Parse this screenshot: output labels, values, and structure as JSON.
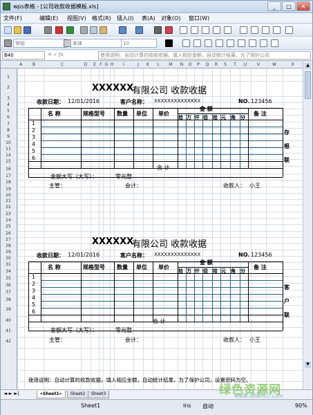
{
  "window": {
    "title": "wps表格 - [公司收款收据模板.xls]",
    "min": "_",
    "max": "□",
    "close": "✕"
  },
  "menu": [
    "文件(F)",
    "编辑(E)",
    "视图(V)",
    "格式(R)",
    "插入(I)",
    "表(A)",
    "对象(O)",
    "窗口(W)"
  ],
  "format_bar": {
    "style": "常规",
    "font": "宋体",
    "size": "10"
  },
  "formula_bar": {
    "name_box": "B40",
    "value": "使用说明：自动计算的收款收据，填入相应金额，自动统计结果，为了保护公司"
  },
  "columns": [
    "A",
    "B",
    "C",
    "D",
    "E",
    "F",
    "G",
    "H",
    "I",
    "J",
    "K",
    "L",
    "M",
    "N",
    "O",
    "P",
    "Q",
    "R",
    "S",
    "T",
    "U",
    "V",
    "W",
    "X"
  ],
  "rows": [
    "1",
    "2",
    "3",
    "4",
    "5",
    "6",
    "7",
    "8",
    "9",
    "10",
    "11",
    "14",
    "15",
    "16",
    "17",
    "18",
    "19",
    "20",
    "21",
    "22",
    "23",
    "24",
    "25",
    "26",
    "27",
    "28",
    "29",
    "30",
    "31",
    "34",
    "35",
    "36",
    "37",
    "38",
    "39",
    "40",
    "41",
    "42"
  ],
  "receipt": {
    "title_x": "XXXXXX",
    "title_rest": "有限公司  收款收据",
    "date_label": "收款日期：",
    "date_value": "12/01/2016",
    "client_label": "客户名称：",
    "client_value": "XXXXXXXXXXXXXX",
    "no_label": "NO.",
    "no_value": "123456",
    "h_name": "名  称",
    "h_spec": "规格型号",
    "h_qty": "数量",
    "h_unit": "单位",
    "h_price": "单价",
    "h_amount": "金      额",
    "h_remark": "备    注",
    "digits": [
      "拾",
      "万",
      "仟",
      "佰",
      "拾",
      "元",
      "角",
      "分"
    ],
    "items": [
      "1",
      "2",
      "3",
      "4",
      "5",
      "6"
    ],
    "total_label": "合  计",
    "amt_words_label": "金额大写（大写）：",
    "amt_words_value": "零元整",
    "manager": "主管：",
    "accountant": "会计：",
    "payee_label": "收款人：",
    "payee_value": "小王"
  },
  "copy1": [
    "存",
    "根",
    "联"
  ],
  "copy2": [
    "客",
    "户",
    "联"
  ],
  "note": "使用说明：自动计算的收款收据，填入相应金额，自动统计结果，为了保护公司，设置密码为空。",
  "sheets": [
    "«Sheet1»",
    "Sheet2",
    "Sheet3"
  ],
  "status": {
    "sheet": "Sheet1",
    "ins": "Ins",
    "auto": "自动",
    "zoom": "90%"
  },
  "watermark": {
    "text": "绿色资源网",
    "url": "www.downcc.com"
  }
}
